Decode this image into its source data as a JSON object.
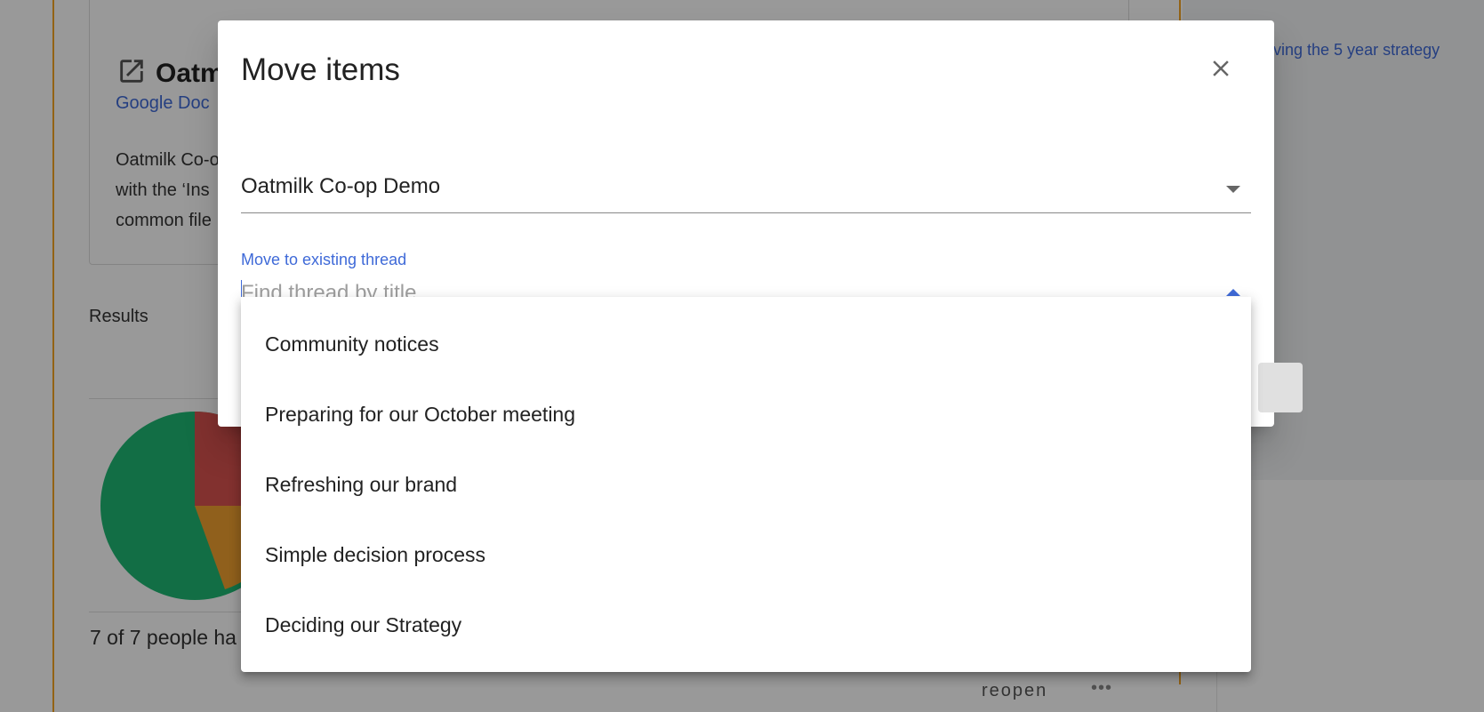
{
  "background": {
    "doc_card": {
      "title": "Oatm",
      "type": "Google Doc",
      "description_lines": [
        "Oatmilk Co-o",
        "with the ‘Ins",
        "common file"
      ]
    },
    "results_label": "Results",
    "voted_text": "7 of 7 people ha",
    "reopen_label": "reopen",
    "more_icon": "more-horizontal-icon",
    "side_link": "ving the 5 year strategy",
    "pie_colors": [
      "#1fb873",
      "#d9534f",
      "#f0a030"
    ]
  },
  "dialog": {
    "title": "Move items",
    "close_icon": "close-icon",
    "group_select": {
      "value": "Oatmilk Co-op Demo"
    },
    "thread_field": {
      "label": "Move to existing thread",
      "value": "",
      "placeholder": "Find thread by title"
    },
    "thread_options": [
      "Community notices",
      "Preparing for our October meeting",
      "Refreshing our brand",
      "Simple decision process",
      "Deciding our Strategy"
    ]
  },
  "colors": {
    "accent": "#3f6ad8",
    "orange_rule": "#f5a623"
  }
}
